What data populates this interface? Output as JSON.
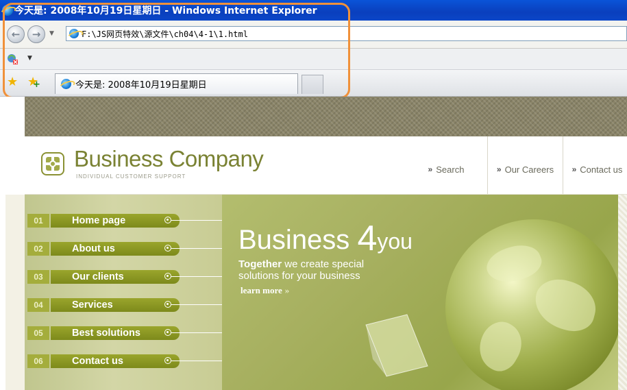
{
  "browser": {
    "window_title": "今天是: 2008年10月19日星期日 - Windows Internet Explorer",
    "address": "F:\\JS网页特效\\源文件\\ch04\\4-1\\1.html",
    "tab_title": "今天是: 2008年10月19日星期日"
  },
  "site": {
    "logo_title": "Business Company",
    "logo_subtitle": "INDIVIDUAL CUSTOMER SUPPORT",
    "top_nav": [
      {
        "label": "Search"
      },
      {
        "label": "Our Careers"
      },
      {
        "label": "Contact us"
      }
    ],
    "menu": [
      {
        "num": "01",
        "label": "Home page"
      },
      {
        "num": "02",
        "label": "About us"
      },
      {
        "num": "03",
        "label": "Our clients"
      },
      {
        "num": "04",
        "label": "Services"
      },
      {
        "num": "05",
        "label": "Best solutions"
      },
      {
        "num": "06",
        "label": "Contact us"
      }
    ],
    "hero": {
      "title_word": "Business",
      "title_number": "4",
      "title_suffix": "you",
      "tagline_bold": "Together",
      "tagline_rest": " we create special",
      "tagline_line2": "solutions for your business",
      "link": "learn more"
    }
  },
  "icons": {
    "back": "back-arrow-icon",
    "forward": "forward-arrow-icon",
    "feed": "feed-icon",
    "favorites": "favorites-star-icon",
    "add_favorite": "add-favorite-icon"
  },
  "colors": {
    "titlebar": "#0a46c8",
    "highlight": "#f0913a",
    "brand_green": "#7a8233",
    "menu_green": "#8a9624"
  }
}
